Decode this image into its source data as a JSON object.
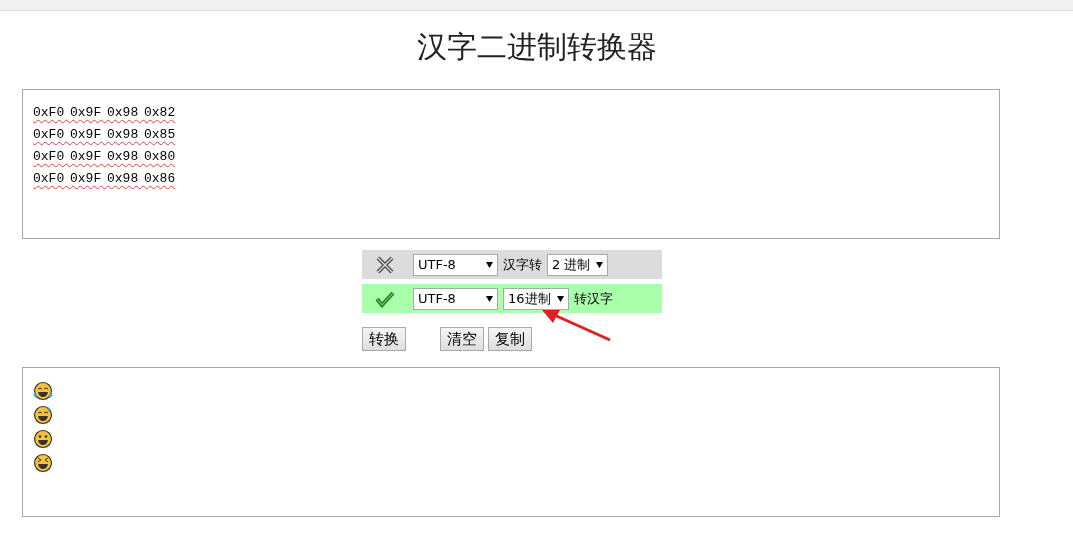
{
  "title": "汉字二进制转换器",
  "input": {
    "lines": [
      "0xF0 0x9F 0x98 0x82",
      "0xF0 0x9F 0x98 0x85",
      "0xF0 0x9F 0x98 0x80",
      "0xF0 0x9F 0x98 0x86"
    ]
  },
  "modes": [
    {
      "kind": "reverse",
      "selected": false,
      "items": [
        {
          "kind": "select",
          "value": "UTF-8"
        },
        {
          "kind": "text",
          "text": "汉字转"
        },
        {
          "kind": "select",
          "value": "2 进制"
        }
      ]
    },
    {
      "kind": "forward",
      "selected": true,
      "items": [
        {
          "kind": "select",
          "value": "UTF-8"
        },
        {
          "kind": "select",
          "value": "16进制"
        },
        {
          "kind": "text",
          "text": "转汉字"
        }
      ]
    }
  ],
  "buttons": [
    {
      "label": "转换"
    },
    {
      "label": "清空"
    },
    {
      "label": "复制"
    }
  ],
  "output": {
    "lines": [
      {
        "kind": "tears-of-joy"
      },
      {
        "kind": "sweat-smile"
      },
      {
        "kind": "grin"
      },
      {
        "kind": "squint-grin"
      }
    ]
  }
}
